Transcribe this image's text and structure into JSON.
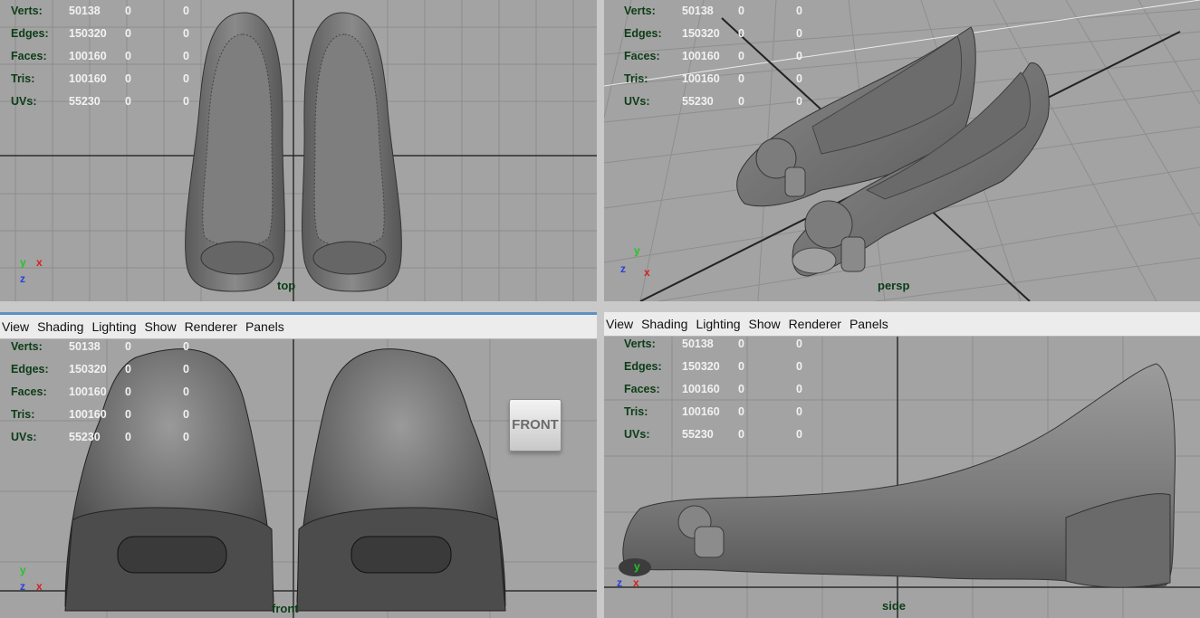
{
  "menu": [
    "View",
    "Shading",
    "Lighting",
    "Show",
    "Renderer",
    "Panels"
  ],
  "hud": {
    "rows": [
      {
        "label": "Verts:",
        "v1": "50138",
        "v2": "0",
        "v3": "0"
      },
      {
        "label": "Edges:",
        "v1": "150320",
        "v2": "0",
        "v3": "0"
      },
      {
        "label": "Faces:",
        "v1": "100160",
        "v2": "0",
        "v3": "0"
      },
      {
        "label": "Tris:",
        "v1": "100160",
        "v2": "0",
        "v3": "0"
      },
      {
        "label": "UVs:",
        "v1": "55230",
        "v2": "0",
        "v3": "0"
      }
    ]
  },
  "viewports": {
    "top": {
      "camera": "top"
    },
    "persp": {
      "camera": "persp"
    },
    "front": {
      "camera": "front",
      "viewcube": "FRONT"
    },
    "side": {
      "camera": "side"
    }
  },
  "axes": {
    "x": "x",
    "y": "y",
    "z": "z"
  },
  "colors": {
    "viewport_bg": "#a3a3a3",
    "grid_line": "#8c8c8c",
    "axis_line": "#2c2c2c",
    "hud_label": "#0c3d17",
    "hud_value": "#f2f2f2",
    "x_axis": "#d42020",
    "y_axis": "#25c425",
    "z_axis": "#2a3fd8",
    "active_border": "#5e90c4"
  }
}
